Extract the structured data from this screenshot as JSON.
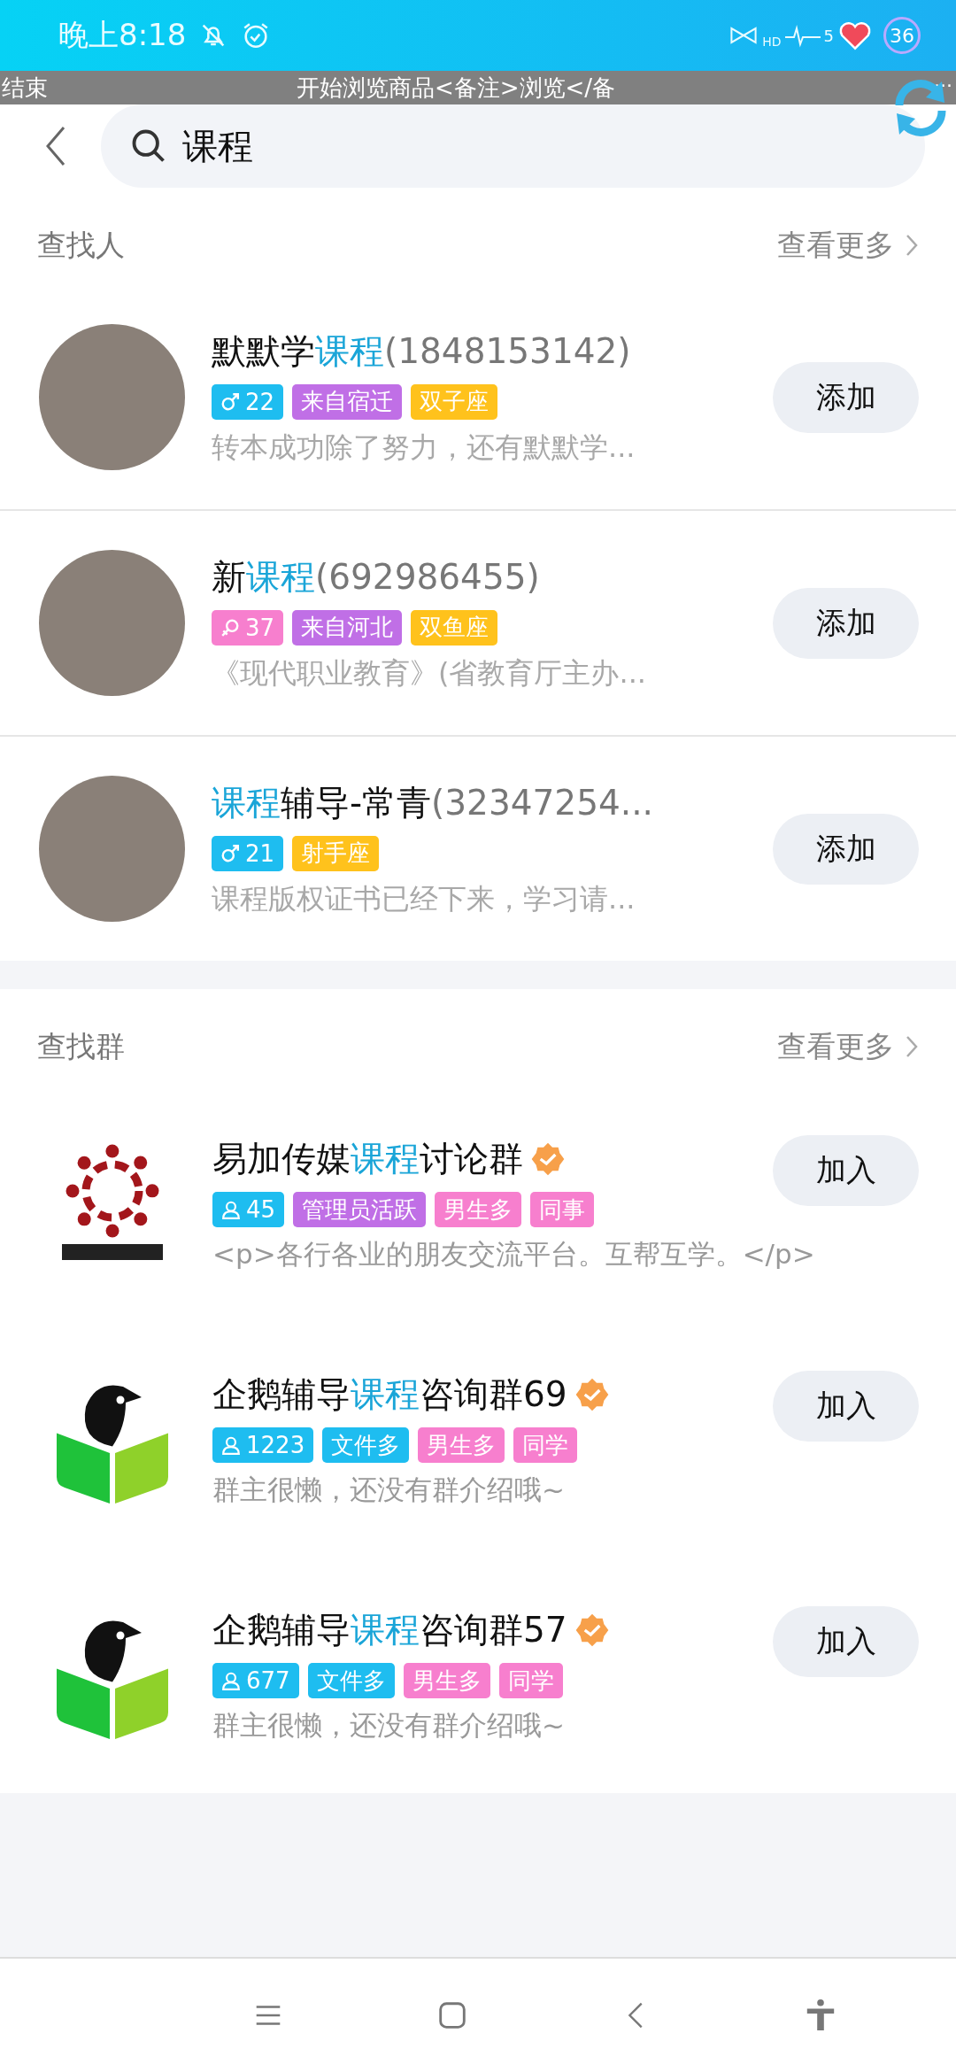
{
  "status_bar": {
    "time": "晚上8:18",
    "hd": "HD",
    "signal": "5",
    "battery": "36"
  },
  "overlay_bar": {
    "left": "结束",
    "center": "开始浏览商品<备注>浏览</备",
    "right": "..."
  },
  "search": {
    "value": "课程"
  },
  "people_section": {
    "title": "查找人",
    "more": "查看更多",
    "rows": [
      {
        "name": [
          {
            "text": "默默学",
            "kind": "plain"
          },
          {
            "text": "课程",
            "kind": "match"
          },
          {
            "text": "(1848153142)",
            "kind": "muted"
          }
        ],
        "tags": [
          {
            "kind": "male",
            "text": "22",
            "color": "#1ebdf0"
          },
          {
            "kind": "label",
            "text": "来自宿迁",
            "color": "#c06fe6"
          },
          {
            "kind": "label",
            "text": "双子座",
            "color": "#ffc21c"
          }
        ],
        "desc": "转本成功除了努力，还有默默学...",
        "button": "添加"
      },
      {
        "name": [
          {
            "text": "新",
            "kind": "plain"
          },
          {
            "text": "课程",
            "kind": "match"
          },
          {
            "text": "(692986455)",
            "kind": "muted"
          }
        ],
        "tags": [
          {
            "kind": "female",
            "text": "37",
            "color": "#f77fce"
          },
          {
            "kind": "label",
            "text": "来自河北",
            "color": "#c06fe6"
          },
          {
            "kind": "label",
            "text": "双鱼座",
            "color": "#ffc21c"
          }
        ],
        "desc": "《现代职业教育》(省教育厅主办...",
        "button": "添加"
      },
      {
        "name": [
          {
            "text": "课程",
            "kind": "match"
          },
          {
            "text": "辅导-常青",
            "kind": "plain"
          },
          {
            "text": "(32347254...",
            "kind": "muted"
          }
        ],
        "tags": [
          {
            "kind": "male",
            "text": "21",
            "color": "#1ebdf0"
          },
          {
            "kind": "label",
            "text": "射手座",
            "color": "#ffc21c"
          }
        ],
        "desc": "课程版权证书已经下来，学习请...",
        "button": "添加"
      }
    ]
  },
  "groups_section": {
    "title": "查找群",
    "more": "查看更多",
    "rows": [
      {
        "kind": "ring",
        "name": [
          {
            "text": "易加传媒",
            "kind": "plain"
          },
          {
            "text": "课程",
            "kind": "match"
          },
          {
            "text": "讨论群",
            "kind": "plain"
          }
        ],
        "verified": true,
        "tags": [
          {
            "kind": "members",
            "text": "45",
            "color": "#1ebdf0"
          },
          {
            "kind": "label",
            "text": "管理员活跃",
            "color": "#c06fe6"
          },
          {
            "kind": "label",
            "text": "男生多",
            "color": "#f77fce"
          },
          {
            "kind": "label",
            "text": "同事",
            "color": "#f77fce"
          }
        ],
        "desc": "<p>各行各业的朋友交流平台。互帮互学。</p>",
        "button": "加入"
      },
      {
        "kind": "penguin",
        "name": [
          {
            "text": "企鹅辅导",
            "kind": "plain"
          },
          {
            "text": "课程",
            "kind": "match"
          },
          {
            "text": "咨询群69",
            "kind": "plain"
          }
        ],
        "verified": true,
        "tags": [
          {
            "kind": "members",
            "text": "1223",
            "color": "#1ebdf0"
          },
          {
            "kind": "label",
            "text": "文件多",
            "color": "#1ebdf0"
          },
          {
            "kind": "label",
            "text": "男生多",
            "color": "#f77fce"
          },
          {
            "kind": "label",
            "text": "同学",
            "color": "#f77fce"
          }
        ],
        "desc": "群主很懒，还没有群介绍哦~",
        "button": "加入"
      },
      {
        "kind": "penguin",
        "name": [
          {
            "text": "企鹅辅导",
            "kind": "plain"
          },
          {
            "text": "课程",
            "kind": "match"
          },
          {
            "text": "咨询群57",
            "kind": "plain"
          }
        ],
        "verified": true,
        "tags": [
          {
            "kind": "members",
            "text": "677",
            "color": "#1ebdf0"
          },
          {
            "kind": "label",
            "text": "文件多",
            "color": "#1ebdf0"
          },
          {
            "kind": "label",
            "text": "男生多",
            "color": "#f77fce"
          },
          {
            "kind": "label",
            "text": "同学",
            "color": "#f77fce"
          }
        ],
        "desc": "群主很懒，还没有群介绍哦~",
        "button": "加入"
      }
    ]
  }
}
